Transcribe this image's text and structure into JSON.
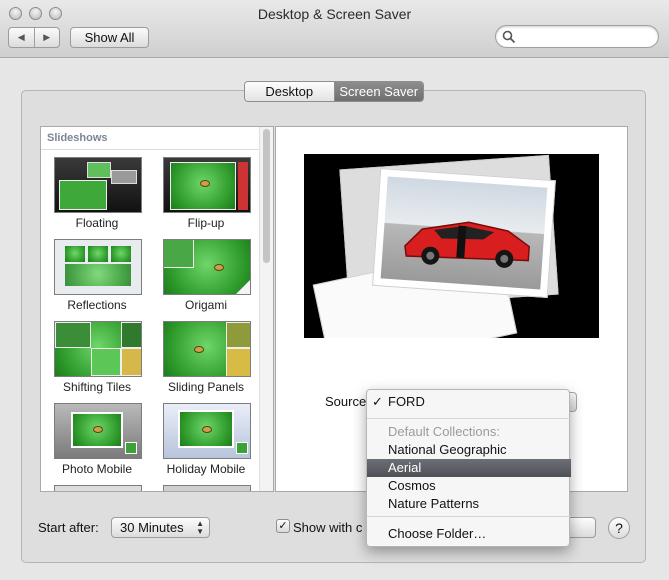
{
  "window": {
    "title": "Desktop & Screen Saver"
  },
  "toolbar": {
    "show_all_label": "Show All",
    "search_placeholder": ""
  },
  "tabs": [
    {
      "label": "Desktop",
      "selected": false
    },
    {
      "label": "Screen Saver",
      "selected": true
    }
  ],
  "slideshows": {
    "header": "Slideshows",
    "items": [
      {
        "label": "Floating"
      },
      {
        "label": "Flip-up"
      },
      {
        "label": "Reflections"
      },
      {
        "label": "Origami"
      },
      {
        "label": "Shifting Tiles"
      },
      {
        "label": "Sliding Panels"
      },
      {
        "label": "Photo Mobile"
      },
      {
        "label": "Holiday Mobile"
      }
    ]
  },
  "source": {
    "label": "Source",
    "menu": {
      "current": "FORD",
      "group_header": "Default Collections:",
      "items": [
        "National Geographic",
        "Aerial",
        "Cosmos",
        "Nature Patterns"
      ],
      "selected_item": "Aerial",
      "choose_folder": "Choose Folder…"
    }
  },
  "bottom": {
    "start_after_label": "Start after:",
    "start_after_value": "30 Minutes",
    "show_with_label": "Show with c",
    "show_with_checked": true,
    "help_label": "?"
  }
}
